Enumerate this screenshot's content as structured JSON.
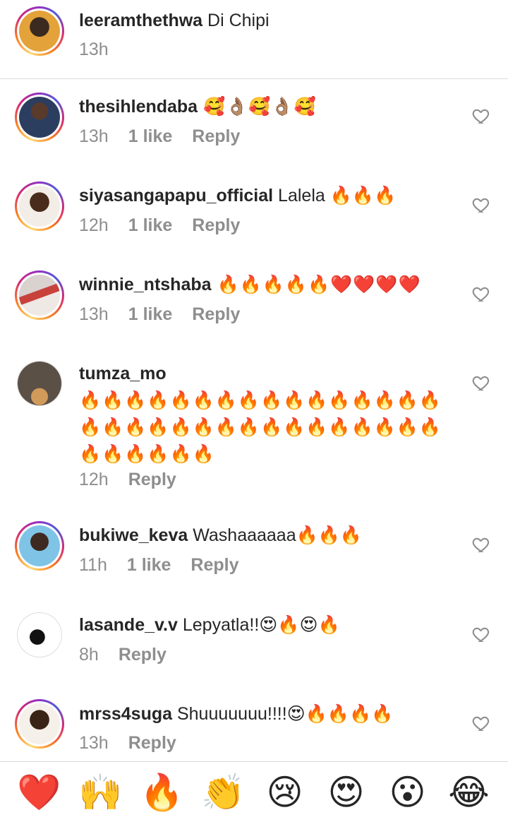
{
  "comments": [
    {
      "username": "leeramthethwa",
      "text": " Di Chipi",
      "time": "13h",
      "likes": "",
      "reply": ""
    },
    {
      "username": "thesihlendaba",
      "text": " 🥰👌🏽🥰👌🏽🥰",
      "time": "13h",
      "likes": "1 like",
      "reply": "Reply"
    },
    {
      "username": "siyasangapapu_official",
      "text": " Lalela 🔥🔥🔥",
      "time": "12h",
      "likes": "1 like",
      "reply": "Reply"
    },
    {
      "username": "winnie_ntshaba",
      "text": " 🔥🔥🔥🔥🔥❤️❤️❤️❤️",
      "time": "13h",
      "likes": "1 like",
      "reply": "Reply"
    },
    {
      "username": "tumza_mo",
      "text": "🔥🔥🔥🔥🔥🔥🔥🔥🔥🔥🔥🔥🔥🔥🔥🔥🔥🔥🔥🔥🔥🔥🔥🔥🔥🔥🔥🔥🔥🔥🔥🔥🔥🔥🔥🔥🔥🔥",
      "time": "12h",
      "likes": "",
      "reply": "Reply"
    },
    {
      "username": "bukiwe_keva",
      "text": " Washaaaaaa🔥🔥🔥",
      "time": "11h",
      "likes": "1 like",
      "reply": "Reply"
    },
    {
      "username": "lasande_v.v",
      "text": " Lepyatla!!😍🔥😍🔥",
      "time": "8h",
      "likes": "",
      "reply": "Reply"
    },
    {
      "username": "mrss4suga",
      "text": " Shuuuuuuu!!!!😍🔥🔥🔥🔥",
      "time": "13h",
      "likes": "",
      "reply": "Reply"
    }
  ],
  "reactions": [
    "❤️",
    "🙌",
    "🔥",
    "👏",
    "😢",
    "😍",
    "😮",
    "😂"
  ],
  "colors": {
    "text": "#262626",
    "muted": "#8e8e8e",
    "divider": "#dbdbdb"
  }
}
